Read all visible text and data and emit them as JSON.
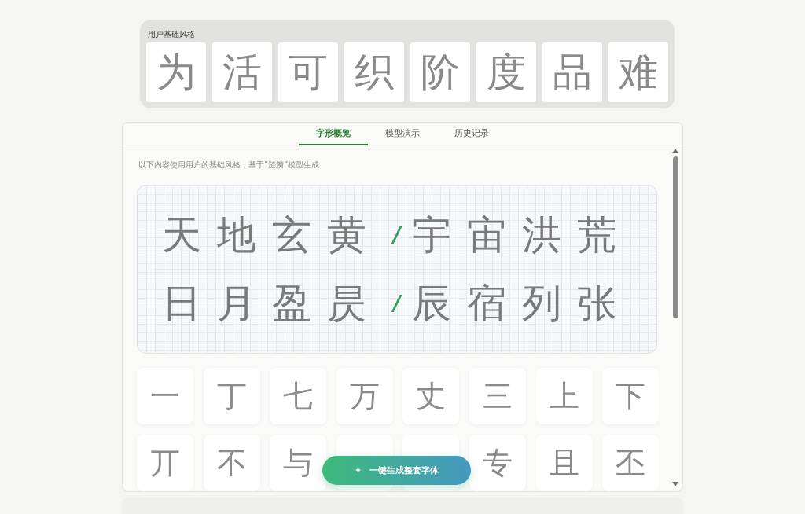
{
  "base_style": {
    "title": "用户基础风格",
    "glyphs": [
      "为",
      "活",
      "可",
      "织",
      "阶",
      "度",
      "品",
      "难"
    ]
  },
  "tabs": [
    {
      "label": "字形概览",
      "selected": true
    },
    {
      "label": "模型演示",
      "selected": false
    },
    {
      "label": "历史记录",
      "selected": false
    }
  ],
  "description": "以下内容使用用户的基础风格，基于“涟漪”模型生成",
  "preview_lines": [
    {
      "left": "天地玄黄",
      "separator": "/",
      "right": "宇宙洪荒"
    },
    {
      "left": "日月盈昃",
      "separator": "/",
      "right": "辰宿列张"
    }
  ],
  "glyph_grid": [
    {
      "kind": "glyph",
      "glyph": "一"
    },
    {
      "kind": "glyph",
      "glyph": "丁"
    },
    {
      "kind": "glyph",
      "glyph": "七"
    },
    {
      "kind": "glyph",
      "glyph": "万"
    },
    {
      "kind": "glyph",
      "glyph": "丈"
    },
    {
      "kind": "glyph",
      "glyph": "三"
    },
    {
      "kind": "glyph",
      "glyph": "上"
    },
    {
      "kind": "glyph",
      "glyph": "下"
    },
    {
      "kind": "glyph",
      "glyph": "丌"
    },
    {
      "kind": "glyph",
      "glyph": "不"
    },
    {
      "kind": "glyph",
      "glyph": "与"
    },
    {
      "kind": "covered"
    },
    {
      "kind": "covered"
    },
    {
      "kind": "glyph",
      "glyph": "专"
    },
    {
      "kind": "glyph",
      "glyph": "且"
    },
    {
      "kind": "glyph",
      "glyph": "丕"
    }
  ],
  "generate_button": {
    "icon": "✦",
    "label": "一键生成整套字体"
  }
}
